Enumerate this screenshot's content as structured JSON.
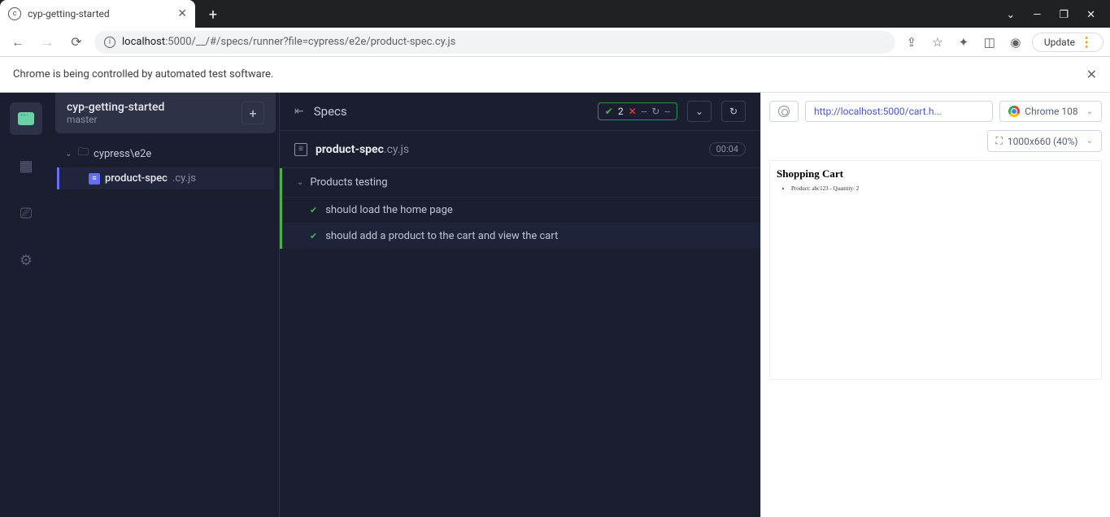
{
  "browser": {
    "tab_title": "cyp-getting-started",
    "url_host": "localhost",
    "url_port": ":5000",
    "url_path": "/__/#/specs/runner?file=cypress/e2e/product-spec.cy.js",
    "update_label": "Update",
    "infobar": "Chrome is being controlled by automated test software."
  },
  "sidebar": {
    "project_name": "cyp-getting-started",
    "branch": "master",
    "folder": "cypress\\e2e",
    "file_name": "product-spec",
    "file_ext": ".cy.js"
  },
  "runner": {
    "header_label": "Specs",
    "pass_count": "2",
    "fail_count": "--",
    "pending_count": "--",
    "spec_name": "product-spec",
    "spec_ext": ".cy.js",
    "duration": "00:04",
    "suite_name": "Products testing",
    "tests": [
      "should load the home page",
      "should add a product to the cart and view the cart"
    ]
  },
  "preview": {
    "url": "http://localhost:5000/cart.h...",
    "browser_label": "Chrome 108",
    "viewport_label": "1000x660 (40%)",
    "page_heading": "Shopping Cart",
    "cart_line": "Product: abc123 - Quantity: 2"
  }
}
